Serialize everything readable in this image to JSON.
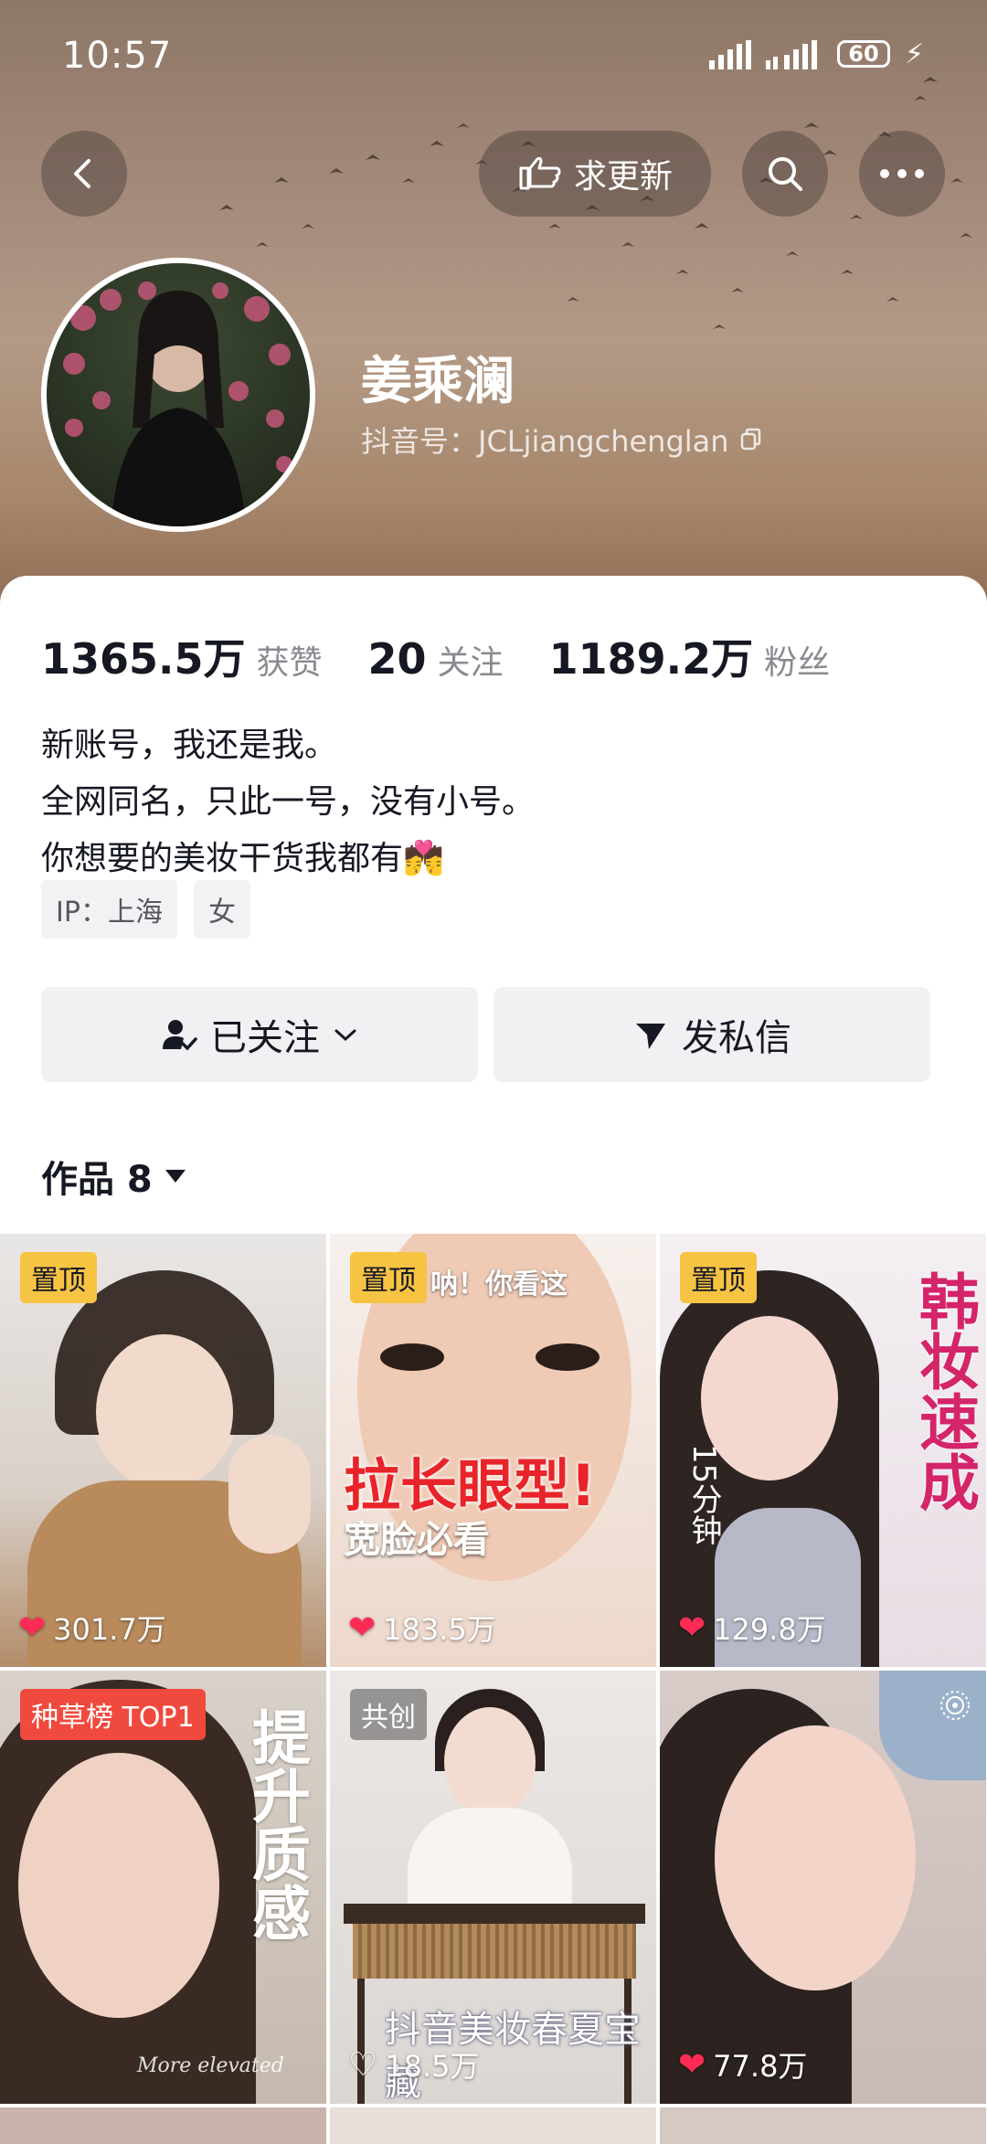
{
  "status_bar": {
    "time": "10:57",
    "battery": "60"
  },
  "header": {
    "request_update_label": "求更新"
  },
  "profile": {
    "name": "姜乘澜",
    "douyin_id": "抖音号：JCLjiangchenglan"
  },
  "stats": [
    {
      "value": "1365.5万",
      "label": "获赞"
    },
    {
      "value": "20",
      "label": "关注"
    },
    {
      "value": "1189.2万",
      "label": "粉丝"
    }
  ],
  "bio": {
    "line1": "新账号，我还是我。",
    "line2": "全网同名，只此一号，没有小号。",
    "line3": "你想要的美妆干货我都有💏"
  },
  "tags": {
    "ip": "IP：上海",
    "gender": "女"
  },
  "actions": {
    "followed": "已关注",
    "message": "发私信"
  },
  "works": {
    "label": "作品 8"
  },
  "videos": [
    {
      "badge": "置顶",
      "likes": "301.7万"
    },
    {
      "badge": "置顶",
      "likes": "183.5万",
      "overlay": "拉长眼型!",
      "sub": "宽脸必看",
      "top_text": "呐！你看这"
    },
    {
      "badge": "置顶",
      "likes": "129.8万",
      "overlay": "韩妆速成",
      "side": "15分钟"
    },
    {
      "badge": "种草榜 TOP1",
      "overlay": "提升质感",
      "caption": "More elevated"
    },
    {
      "badge": "共创",
      "likes": "18.5万",
      "overlay": "抖音美妆春夏宝藏"
    },
    {
      "likes": "77.8万"
    }
  ],
  "colors": {
    "accent_red": "#fe2c55",
    "badge_yellow": "#f6c343",
    "badge_red": "#f04a3e"
  }
}
